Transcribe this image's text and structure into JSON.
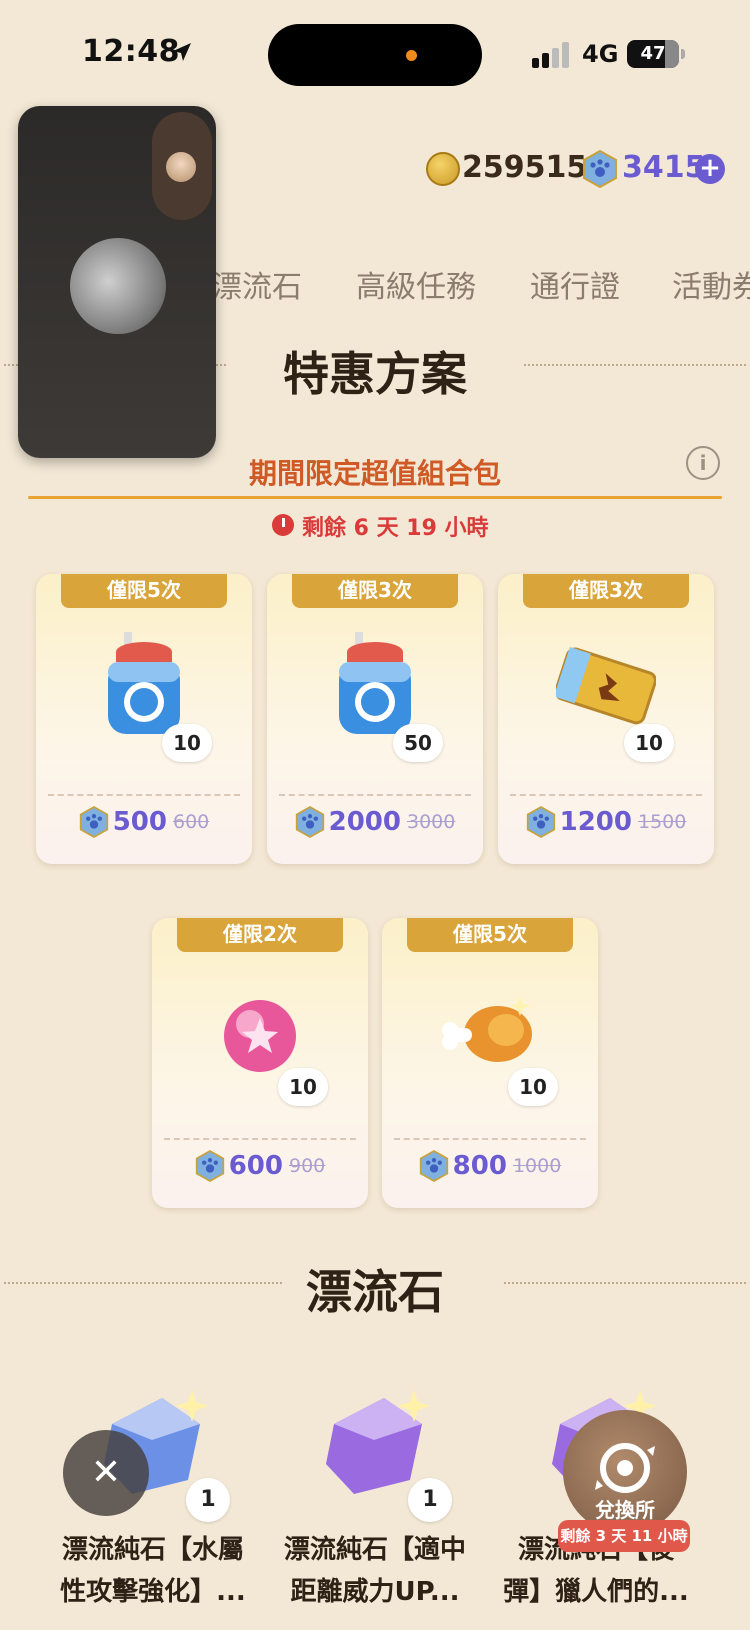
{
  "status_bar": {
    "time": "12:48",
    "network": "4G",
    "battery": "47"
  },
  "currency": {
    "coins": "259515",
    "gems": "3415",
    "plus": "+"
  },
  "tabs": [
    "漂流石",
    "高級任務",
    "通行證",
    "活動券"
  ],
  "special": {
    "title": "特惠方案",
    "subtitle": "期間限定超值組合包",
    "info": "i",
    "timer": "剩餘 6 天 19 小時"
  },
  "cards": [
    {
      "limit": "僅限5次",
      "qty": "10",
      "price": "500",
      "old_price": "600",
      "icon": "blue-jar-icon"
    },
    {
      "limit": "僅限3次",
      "qty": "50",
      "price": "2000",
      "old_price": "3000",
      "icon": "blue-jar-icon"
    },
    {
      "limit": "僅限3次",
      "qty": "10",
      "price": "1200",
      "old_price": "1500",
      "icon": "golden-ticket-icon"
    },
    {
      "limit": "僅限2次",
      "qty": "10",
      "price": "600",
      "old_price": "900",
      "icon": "pink-ball-icon"
    },
    {
      "limit": "僅限5次",
      "qty": "10",
      "price": "800",
      "old_price": "1000",
      "icon": "meat-bone-icon"
    }
  ],
  "drift": {
    "title": "漂流石",
    "items": [
      {
        "name1": "漂流純石【水屬",
        "name2": "性攻擊強化】...",
        "qty": "1"
      },
      {
        "name1": "漂流純石【適中",
        "name2": "距離威力UP...",
        "qty": "1"
      },
      {
        "name1": "漂流純石【後",
        "name2": "彈】獵人們的...",
        "qty": ""
      }
    ]
  },
  "floating": {
    "close": "✕",
    "exchange_label": "兌換所",
    "exchange_timer": "剩餘 3 天 11 小時"
  }
}
